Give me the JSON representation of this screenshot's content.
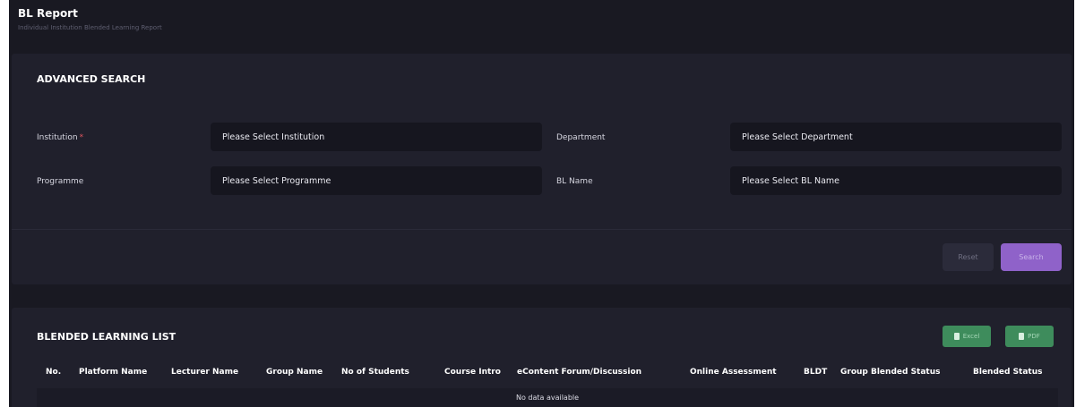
{
  "header": {
    "title": "BL Report",
    "subtitle": "Individual Institution Blended Learning Report"
  },
  "advanced_search": {
    "title": "ADVANCED SEARCH",
    "fields": {
      "institution": {
        "label": "Institution",
        "required_mark": "*",
        "value": "Please Select Institution"
      },
      "department": {
        "label": "Department",
        "value": "Please Select Department"
      },
      "programme": {
        "label": "Programme",
        "value": "Please Select Programme"
      },
      "bl_name": {
        "label": "BL Name",
        "value": "Please Select BL Name"
      }
    },
    "reset_label": "Reset",
    "search_label": "Search"
  },
  "list": {
    "title": "BLENDED LEARNING LIST",
    "excel_label": "Excel",
    "pdf_label": "PDF",
    "columns": [
      "No.",
      "Platform Name",
      "Lecturer Name",
      "Group Name",
      "No of Students",
      "Course Intro",
      "eContent Forum/Discussion",
      "Online Assessment",
      "BLDT",
      "Group Blended Status",
      "Blended Status"
    ],
    "empty_message": "No data available"
  },
  "colors": {
    "background": "#191922",
    "card": "#20202c",
    "input": "#16161f",
    "accent": "#8f62c9",
    "export": "#3e8c5c",
    "required": "#e0555f"
  }
}
